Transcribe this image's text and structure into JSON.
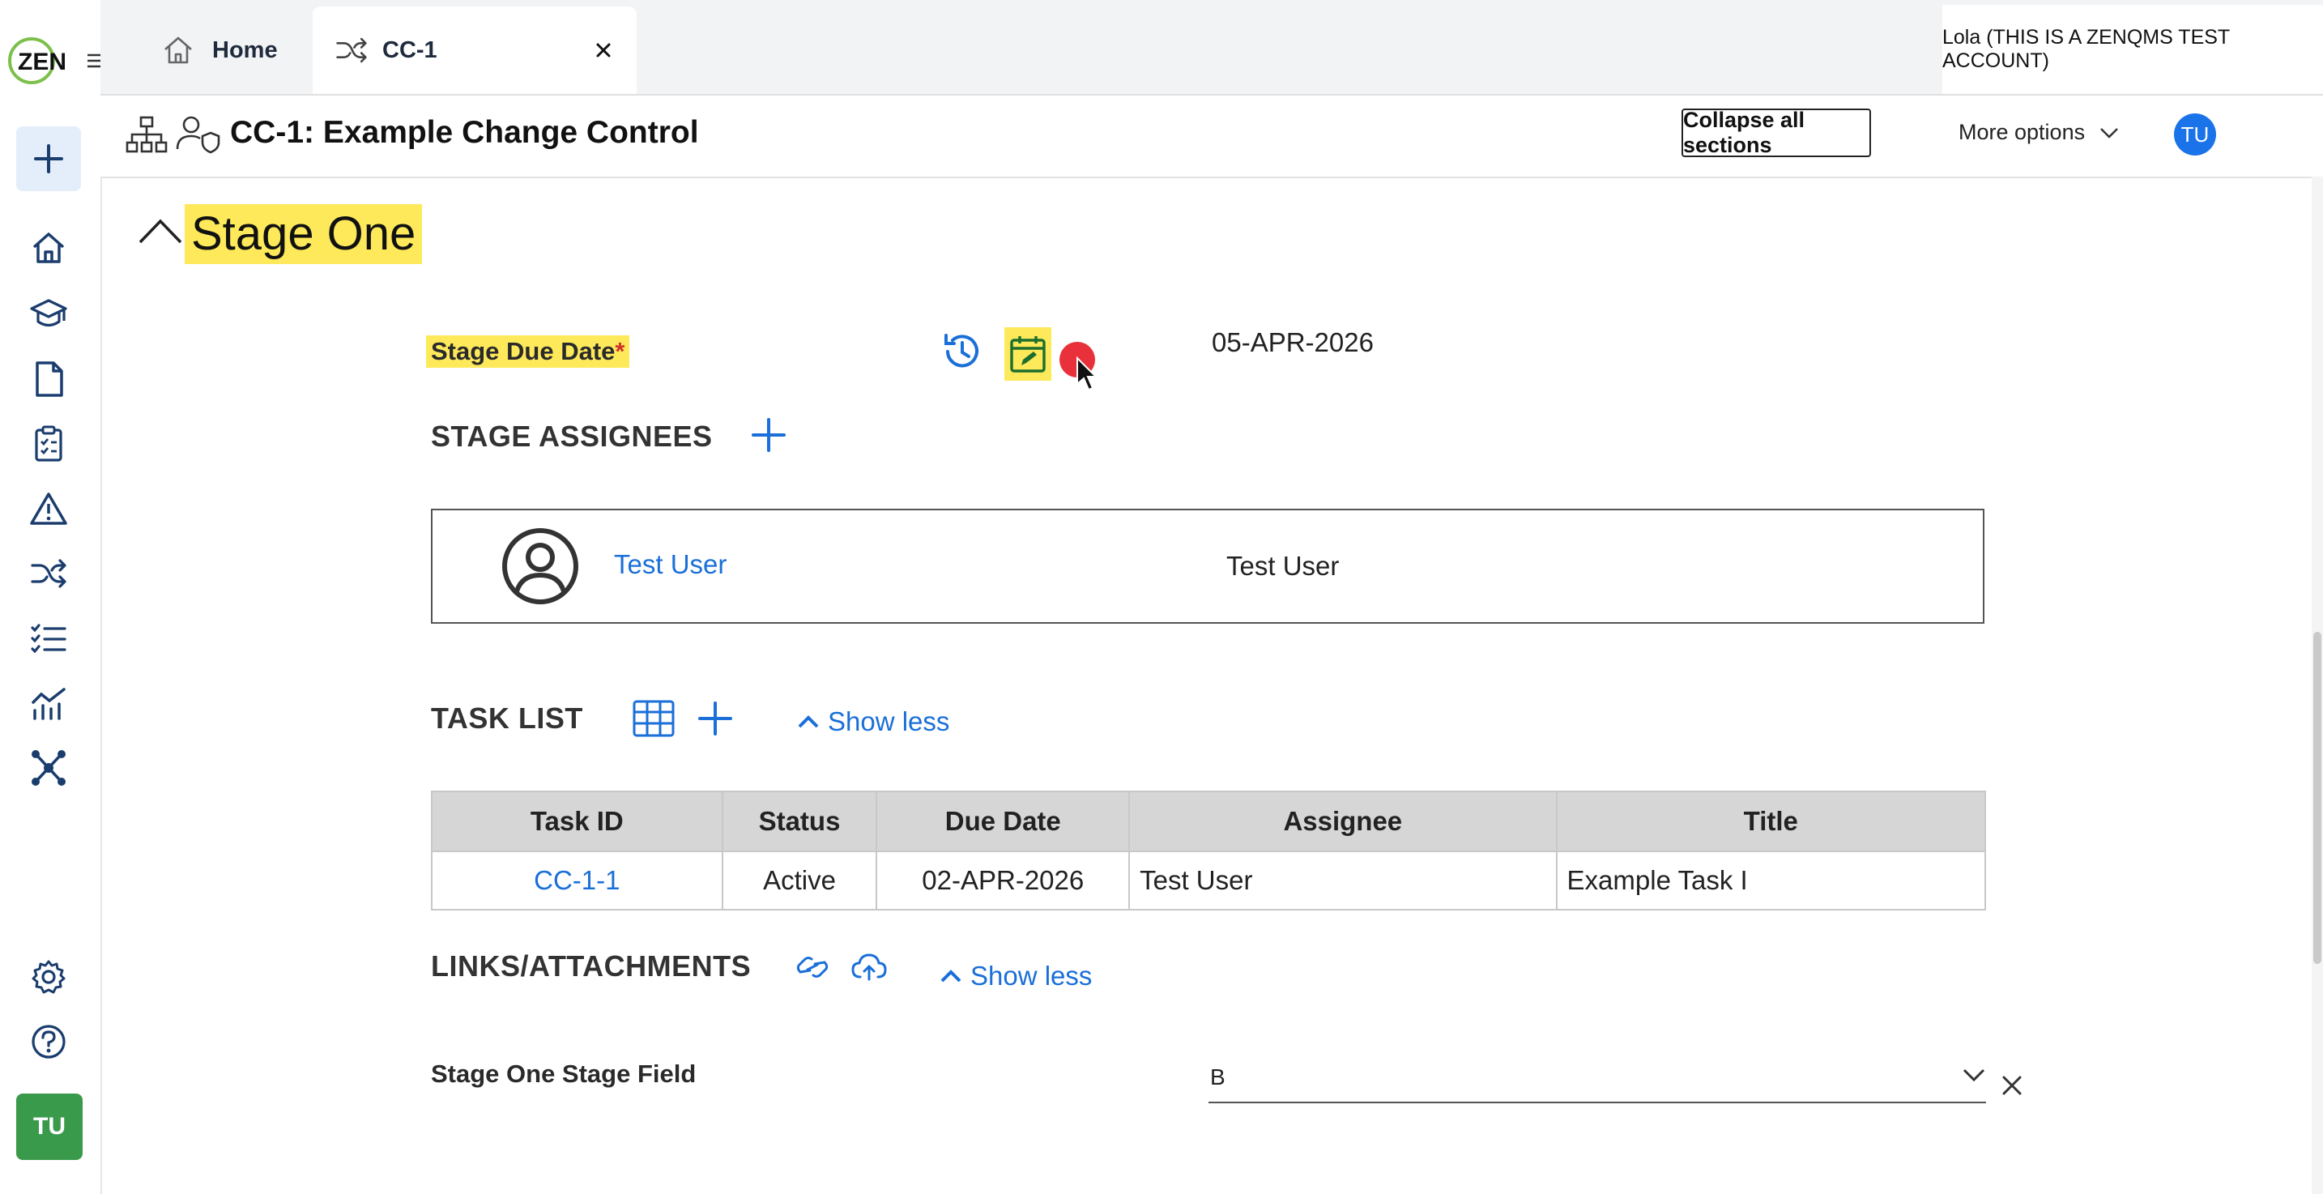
{
  "rail": {
    "logo_text": "ZEN",
    "avatar_initials": "TU"
  },
  "tabs": [
    {
      "label": "Home"
    },
    {
      "label": "CC-1"
    }
  ],
  "account_label": "Lola (THIS IS A ZENQMS TEST ACCOUNT)",
  "record": {
    "title": "CC-1: Example Change Control",
    "collapse_label": "Collapse all sections",
    "more_options_label": "More options",
    "avatar_initials": "TU"
  },
  "stage": {
    "title": "Stage One",
    "due_date_label": "Stage Due Date",
    "required_marker": "*",
    "due_date_value": "05-APR-2026",
    "assignees_label": "STAGE ASSIGNEES",
    "assignee": {
      "name_link": "Test User",
      "name_text": "Test User"
    },
    "task_list_label": "TASK LIST",
    "task_show_less": "Show less",
    "task_table": {
      "columns": [
        "Task ID",
        "Status",
        "Due Date",
        "Assignee",
        "Title"
      ],
      "rows": [
        {
          "task_id": "CC-1-1",
          "status": "Active",
          "due_date": "02-APR-2026",
          "assignee": "Test User",
          "title": "Example Task I"
        }
      ]
    },
    "links_label": "LINKS/ATTACHMENTS",
    "links_show_less": "Show less",
    "stage_field_label": "Stage One Stage Field",
    "stage_field_value": "B"
  },
  "colors": {
    "accent": "#1a6fd8",
    "highlight": "#fde95a",
    "cursor_dot": "#e8313a",
    "avatar_green": "#3a9a4b"
  }
}
